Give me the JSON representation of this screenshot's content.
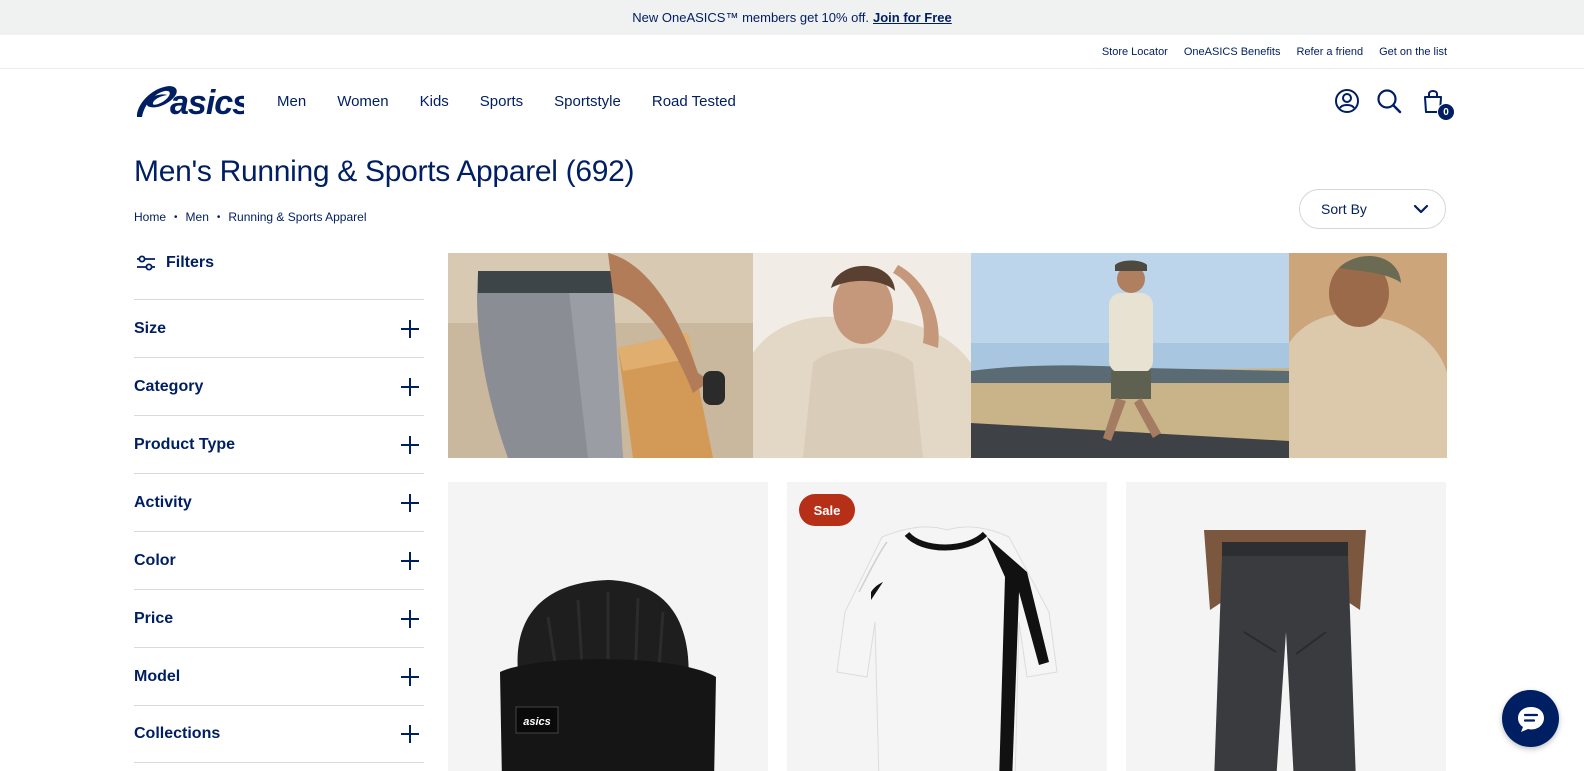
{
  "promo": {
    "message": "New OneASICS™ members get 10% off.",
    "link": "Join for Free"
  },
  "utility_links": [
    "Store Locator",
    "OneASICS Benefits",
    "Refer a friend",
    "Get on the list"
  ],
  "brand": {
    "logo_text": "asics",
    "navy": "#001e62",
    "sale_red": "#b53016"
  },
  "nav": [
    "Men",
    "Women",
    "Kids",
    "Sports",
    "Sportstyle",
    "Road Tested"
  ],
  "header_icons": {
    "account": "user-icon",
    "search": "search-icon",
    "cart": "shopping-bag-icon",
    "cart_count": "0"
  },
  "page": {
    "title": "Men's Running & Sports Apparel (692)",
    "breadcrumb": [
      "Home",
      "Men",
      "Running & Sports Apparel"
    ],
    "sort_label": "Sort By"
  },
  "filters": {
    "heading": "Filters",
    "items": [
      "Size",
      "Category",
      "Product Type",
      "Activity",
      "Color",
      "Price",
      "Model",
      "Collections"
    ]
  },
  "products": [
    {
      "badge": ""
    },
    {
      "badge": "Sale"
    },
    {
      "badge": ""
    }
  ],
  "chat": {
    "icon": "chat-bubble-icon"
  }
}
